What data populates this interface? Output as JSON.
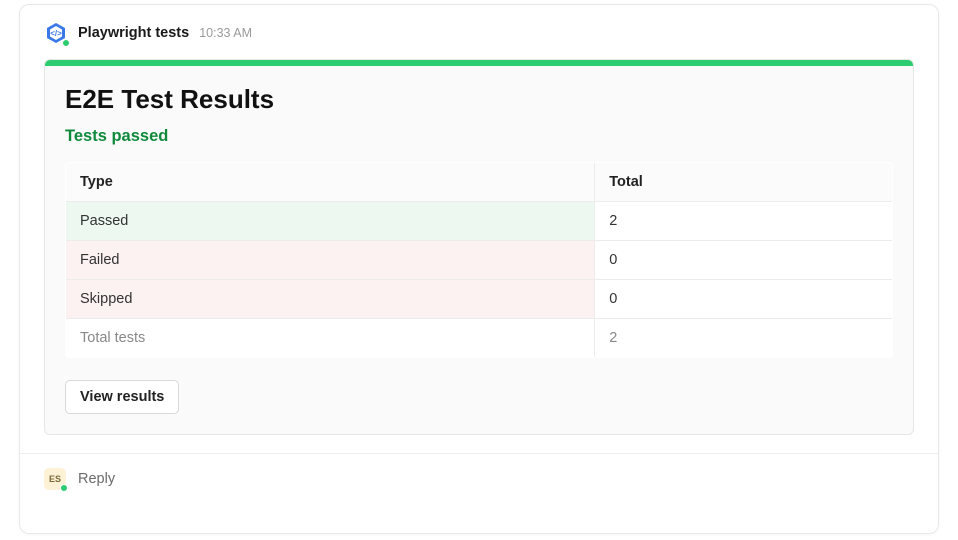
{
  "header": {
    "app_name": "Playwright tests",
    "time": "10:33 AM"
  },
  "panel": {
    "title": "E2E Test Results",
    "subtitle": "Tests passed",
    "accent_color": "#2ecc71",
    "columns": {
      "type": "Type",
      "total": "Total"
    },
    "rows": [
      {
        "key": "passed",
        "type": "Passed",
        "total": "2"
      },
      {
        "key": "failed",
        "type": "Failed",
        "total": "0"
      },
      {
        "key": "skipped",
        "type": "Skipped",
        "total": "0"
      },
      {
        "key": "total",
        "type": "Total tests",
        "total": "2"
      }
    ],
    "button": "View results"
  },
  "reply": {
    "avatar_initials": "ES",
    "placeholder": "Reply"
  }
}
